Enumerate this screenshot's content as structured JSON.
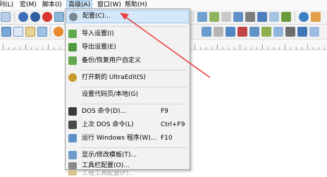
{
  "menubar": {
    "items": [
      {
        "label": "列(L)",
        "active": false
      },
      {
        "label": "宏(M)",
        "active": false
      },
      {
        "label": "脚本(I)",
        "active": false
      },
      {
        "label": "高级(A)",
        "active": true
      },
      {
        "label": "窗口(W)",
        "active": false
      },
      {
        "label": "帮助(H)",
        "active": false
      }
    ]
  },
  "menu": {
    "items": [
      {
        "icon": "gear-icon",
        "label": "配置(C)...",
        "shortcut": "",
        "highlighted": true,
        "disabled": false
      },
      {
        "icon": "import-settings-icon",
        "label": "导入设置(I)",
        "shortcut": "",
        "highlighted": false,
        "disabled": false
      },
      {
        "icon": "export-settings-icon",
        "label": "导出设置(E)",
        "shortcut": "",
        "highlighted": false,
        "disabled": false
      },
      {
        "icon": "backup-restore-icon",
        "label": "备份/恢复用户自定义",
        "shortcut": "",
        "highlighted": false,
        "disabled": false
      },
      {
        "icon": "ultraedit-icon",
        "label": "打开新的 UltraEdit(S)",
        "shortcut": "",
        "highlighted": false,
        "disabled": false
      },
      {
        "icon": "code-page-icon",
        "label": "设置代码页/本地(G)",
        "shortcut": "",
        "highlighted": false,
        "disabled": false
      },
      {
        "icon": "dos-command-icon",
        "label": "DOS 命令(D)...",
        "shortcut": "F9",
        "highlighted": false,
        "disabled": false
      },
      {
        "icon": "last-dos-command-icon",
        "label": "上次 DOS 命令(L)",
        "shortcut": "Ctrl+F9",
        "highlighted": false,
        "disabled": false
      },
      {
        "icon": "run-windows-program-icon",
        "label": "运行 Windows 程序(W)...",
        "shortcut": "F10",
        "highlighted": false,
        "disabled": false
      },
      {
        "icon": "template-icon",
        "label": "显示/修改模板(T)...",
        "shortcut": "",
        "highlighted": false,
        "disabled": false
      },
      {
        "icon": "toolbar-config-icon",
        "label": "工具栏配置(O)...",
        "shortcut": "",
        "highlighted": false,
        "disabled": false
      },
      {
        "icon": "tool-config-icon",
        "label": "工程工具配置(P)...",
        "shortcut": "",
        "highlighted": false,
        "disabled": true
      }
    ]
  },
  "colors": {
    "menu_highlight": "#d5e8f9",
    "menubar_active": "#cce4f7",
    "annotation_arrow": "#e8403f"
  }
}
